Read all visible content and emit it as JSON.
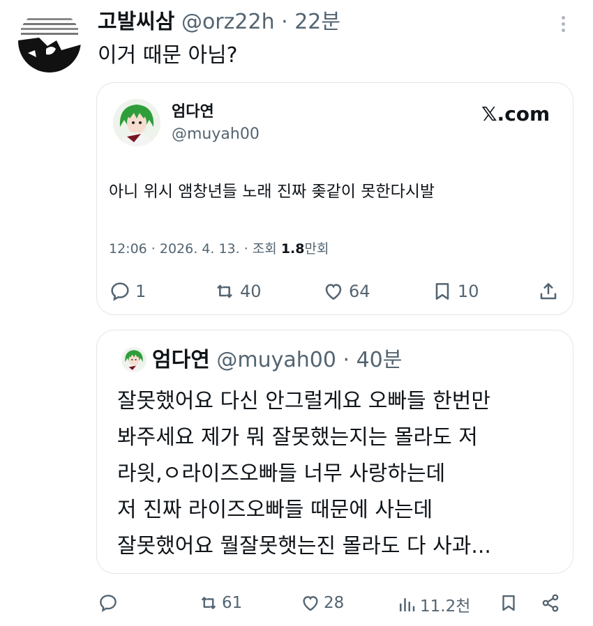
{
  "tweet": {
    "author_name": "고발씨삼",
    "author_handle": "@orz22h",
    "separator": "·",
    "time": "22분",
    "text": "이거 때문 아님?"
  },
  "quoted_card": {
    "name": "엄다연",
    "handle": "@muyah00",
    "site": "𝕏.com",
    "text": "아니 위시 앰창년들 노래 진짜 좆같이 못한다시발",
    "meta_prefix": "12:06 · 2026. 4. 13. · 조회 ",
    "views_bold": "1.8",
    "views_suffix": "만회",
    "actions": {
      "replies": "1",
      "retweets": "40",
      "likes": "64",
      "bookmarks": "10"
    }
  },
  "reply_card": {
    "name": "엄다연",
    "handle": "@muyah00",
    "separator": "·",
    "time": "40분",
    "lines": [
      "잘못했어요 다신 안그럴게요 오빠들 한번만",
      "봐주세요 제가 뭐 잘못했는지는 몰라도 저",
      "라읫,ㅇ라이즈오빠들 너무 사랑하는데",
      "저 진짜 라이즈오빠들 때문에 사는데",
      "잘못했어요 뭘잘못햇는진 몰라도 다 사과..."
    ]
  },
  "bottom_actions": {
    "retweets": "61",
    "likes": "28",
    "views": "11.2천"
  },
  "colors": {
    "text": "#0f1419",
    "muted": "#536471",
    "border": "#e1e6ea"
  }
}
